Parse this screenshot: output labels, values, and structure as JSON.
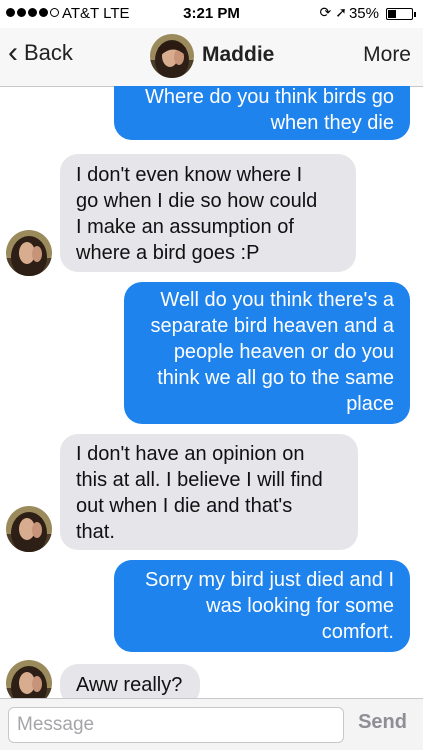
{
  "status_bar": {
    "carrier": "AT&T  LTE",
    "time": "3:21 PM",
    "battery_percent": "35%",
    "battery_level": 0.35,
    "icons": [
      "rotation-lock-icon",
      "location-arrow-icon"
    ]
  },
  "nav": {
    "back_label": "Back",
    "contact_name": "Maddie",
    "more_label": "More"
  },
  "messages": [
    {
      "direction": "sent",
      "text": "Where do you think birds go\nwhen they die"
    },
    {
      "direction": "received",
      "text": "I don't even know where I\ngo when I die so how could\nI make an assumption of\nwhere a bird goes :P"
    },
    {
      "direction": "sent",
      "text": "Well do you think there's a\nseparate bird heaven and a\npeople heaven or do you\nthink we all go to the same\nplace"
    },
    {
      "direction": "received",
      "text": "I don't have an opinion on\nthis at all. I believe I will find\nout when I die and that's\nthat."
    },
    {
      "direction": "sent",
      "text": "Sorry my bird just died and I\nwas looking for some\ncomfort."
    },
    {
      "direction": "received",
      "text": "Aww really?"
    }
  ],
  "composer": {
    "placeholder": "Message",
    "send_label": "Send"
  },
  "colors": {
    "sent_bubble": "#1e83ec",
    "received_bubble": "#e5e5ea",
    "send_disabled": "#8e8e93"
  }
}
